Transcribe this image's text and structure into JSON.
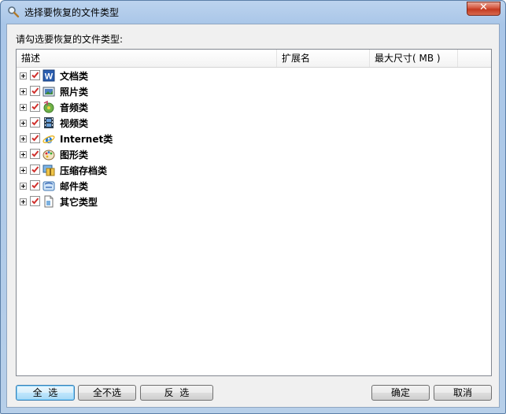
{
  "window": {
    "title": "选择要恢复的文件类型",
    "close_label": "✕"
  },
  "prompt": "请勾选要恢复的文件类型:",
  "columns": {
    "description": "描述",
    "extension": "扩展名",
    "max_size": "最大尺寸( MB )"
  },
  "items": [
    {
      "label": "文档类",
      "checked": true,
      "icon": "word-document-icon"
    },
    {
      "label": "照片类",
      "checked": true,
      "icon": "photo-icon"
    },
    {
      "label": "音频类",
      "checked": true,
      "icon": "audio-icon"
    },
    {
      "label": "视频类",
      "checked": true,
      "icon": "video-film-icon"
    },
    {
      "label": "Internet类",
      "checked": true,
      "icon": "internet-explorer-icon"
    },
    {
      "label": "图形类",
      "checked": true,
      "icon": "graphics-palette-icon"
    },
    {
      "label": "压缩存档类",
      "checked": true,
      "icon": "archive-icon"
    },
    {
      "label": "邮件类",
      "checked": true,
      "icon": "mail-icon"
    },
    {
      "label": "其它类型",
      "checked": true,
      "icon": "other-file-icon"
    }
  ],
  "buttons": {
    "select_all": "全  选",
    "select_none": "全不选",
    "invert": "反  选",
    "ok": "确定",
    "cancel": "取消"
  },
  "colors": {
    "check_mark": "#d0312d",
    "titlebar": "#a9c6e8",
    "close_button": "#c33a20"
  }
}
